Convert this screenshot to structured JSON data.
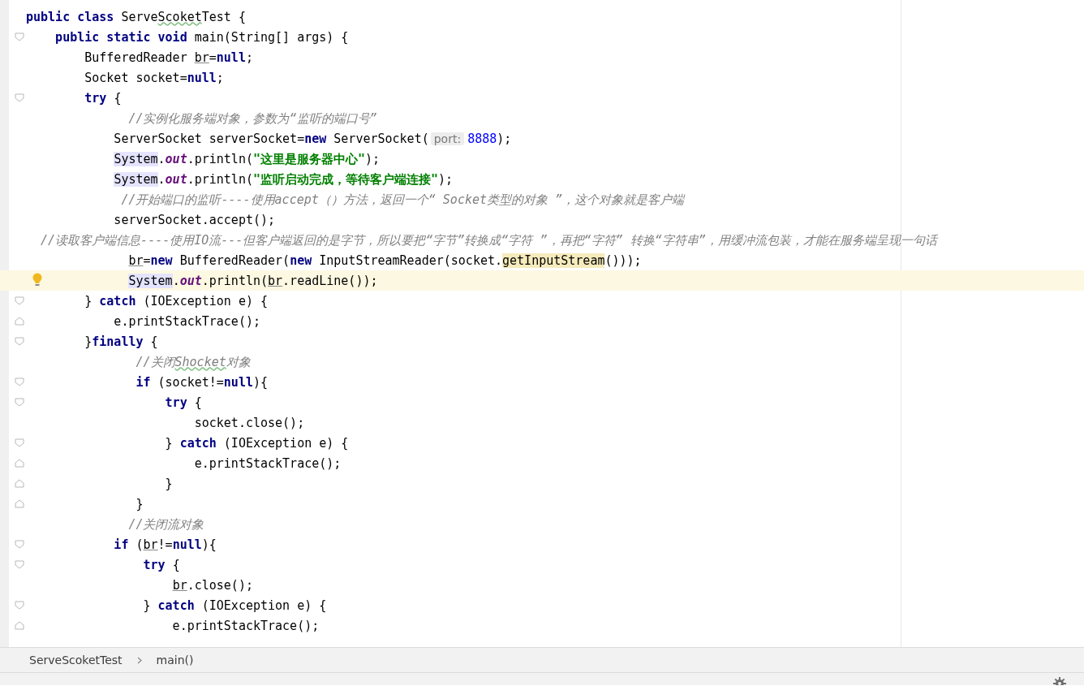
{
  "editor": {
    "lines": [
      {
        "current": false,
        "tokens": [
          {
            "kind": "keyword",
            "text": "public class "
          },
          {
            "kind": "plain",
            "text": "Serve"
          },
          {
            "kind": "typo",
            "text": "Scoket"
          },
          {
            "kind": "plain",
            "text": "Test {"
          }
        ]
      },
      {
        "current": false,
        "fold_start": true,
        "tokens": [
          {
            "kind": "keyword",
            "text": "    public static void "
          },
          {
            "kind": "plain",
            "text": "main(String[] args) {"
          }
        ]
      },
      {
        "current": false,
        "tokens": [
          {
            "kind": "plain",
            "text": "        BufferedReader "
          },
          {
            "kind": "underlined",
            "text": "br"
          },
          {
            "kind": "plain",
            "text": "="
          },
          {
            "kind": "keyword",
            "text": "null"
          },
          {
            "kind": "plain",
            "text": ";"
          }
        ]
      },
      {
        "current": false,
        "tokens": [
          {
            "kind": "plain",
            "text": "        Socket socket="
          },
          {
            "kind": "keyword",
            "text": "null"
          },
          {
            "kind": "plain",
            "text": ";"
          }
        ]
      },
      {
        "current": false,
        "fold_start": true,
        "tokens": [
          {
            "kind": "keyword",
            "text": "        try "
          },
          {
            "kind": "plain",
            "text": "{"
          }
        ]
      },
      {
        "current": false,
        "tokens": [
          {
            "kind": "comment",
            "text": "              //实例化服务端对象，参数为“监听的端口号”"
          }
        ]
      },
      {
        "current": false,
        "tokens": [
          {
            "kind": "plain",
            "text": "            ServerSocket serverSocket="
          },
          {
            "kind": "keyword",
            "text": "new "
          },
          {
            "kind": "plain",
            "text": "ServerSocket("
          },
          {
            "kind": "hint",
            "text": "port:"
          },
          {
            "kind": "number",
            "text": "8888"
          },
          {
            "kind": "plain",
            "text": ");"
          }
        ]
      },
      {
        "current": false,
        "tokens": [
          {
            "kind": "class-ref",
            "text": "            System"
          },
          {
            "kind": "plain",
            "text": "."
          },
          {
            "kind": "field",
            "text": "out"
          },
          {
            "kind": "plain",
            "text": ".println("
          },
          {
            "kind": "string",
            "text": "\"这里是服务器中心\""
          },
          {
            "kind": "plain",
            "text": ");"
          }
        ]
      },
      {
        "current": false,
        "tokens": [
          {
            "kind": "class-ref",
            "text": "            System"
          },
          {
            "kind": "plain",
            "text": "."
          },
          {
            "kind": "field",
            "text": "out"
          },
          {
            "kind": "plain",
            "text": ".println("
          },
          {
            "kind": "string",
            "text": "\"监听启动完成，等待客户端连接\""
          },
          {
            "kind": "plain",
            "text": ");"
          }
        ]
      },
      {
        "current": false,
        "tokens": [
          {
            "kind": "comment",
            "text": "             //开始端口的监听----使用accept（）方法，返回一个“ Socket类型的对象 ”，这个对象就是客户端"
          }
        ]
      },
      {
        "current": false,
        "tokens": [
          {
            "kind": "plain",
            "text": "            serverSocket.accept();"
          }
        ]
      },
      {
        "current": false,
        "tokens": [
          {
            "kind": "comment",
            "text": "  //读取客户端信息----使用IO流---但客户端返回的是字节，所以要把“字节”转换成“字符 ”，再把“字符” 转换“字符串”，用缓冲流包装，才能在服务端呈现一句话"
          }
        ]
      },
      {
        "current": false,
        "tokens": [
          {
            "kind": "underlined",
            "text": "              br"
          },
          {
            "kind": "plain",
            "text": "="
          },
          {
            "kind": "keyword",
            "text": "new "
          },
          {
            "kind": "plain",
            "text": "BufferedReader("
          },
          {
            "kind": "keyword",
            "text": "new "
          },
          {
            "kind": "plain",
            "text": "InputStreamReader(socket."
          },
          {
            "kind": "highlighted",
            "text": "getInputStream"
          },
          {
            "kind": "plain",
            "text": "()));"
          }
        ]
      },
      {
        "current": true,
        "bulb": true,
        "tokens": [
          {
            "kind": "class-ref",
            "text": "              System"
          },
          {
            "kind": "plain",
            "text": "."
          },
          {
            "kind": "field",
            "text": "out"
          },
          {
            "kind": "plain",
            "text": ".println("
          },
          {
            "kind": "underlined",
            "text": "br"
          },
          {
            "kind": "plain",
            "text": ".readLine());"
          }
        ]
      },
      {
        "current": false,
        "fold_start": true,
        "tokens": [
          {
            "kind": "plain",
            "text": "        } "
          },
          {
            "kind": "keyword",
            "text": "catch "
          },
          {
            "kind": "plain",
            "text": "(IOException e) {"
          }
        ]
      },
      {
        "current": false,
        "fold_end": true,
        "tokens": [
          {
            "kind": "plain",
            "text": "            e.printStackTrace();"
          }
        ]
      },
      {
        "current": false,
        "fold_start": true,
        "tokens": [
          {
            "kind": "plain",
            "text": "        }"
          },
          {
            "kind": "keyword",
            "text": "finally "
          },
          {
            "kind": "plain",
            "text": "{"
          }
        ]
      },
      {
        "current": false,
        "tokens": [
          {
            "kind": "comment",
            "text": "               //关闭"
          },
          {
            "kind": "comment-typo",
            "text": "Shocket"
          },
          {
            "kind": "comment",
            "text": "对象"
          }
        ]
      },
      {
        "current": false,
        "fold_start": true,
        "tokens": [
          {
            "kind": "keyword",
            "text": "               if "
          },
          {
            "kind": "plain",
            "text": "(socket!="
          },
          {
            "kind": "keyword",
            "text": "null"
          },
          {
            "kind": "plain",
            "text": "){"
          }
        ]
      },
      {
        "current": false,
        "fold_start": true,
        "tokens": [
          {
            "kind": "keyword",
            "text": "                   try "
          },
          {
            "kind": "plain",
            "text": "{"
          }
        ]
      },
      {
        "current": false,
        "tokens": [
          {
            "kind": "plain",
            "text": "                       socket.close();"
          }
        ]
      },
      {
        "current": false,
        "fold_start": true,
        "tokens": [
          {
            "kind": "plain",
            "text": "                   } "
          },
          {
            "kind": "keyword",
            "text": "catch "
          },
          {
            "kind": "plain",
            "text": "(IOException e) {"
          }
        ]
      },
      {
        "current": false,
        "fold_end": true,
        "tokens": [
          {
            "kind": "plain",
            "text": "                       e.printStackTrace();"
          }
        ]
      },
      {
        "current": false,
        "fold_end": true,
        "tokens": [
          {
            "kind": "plain",
            "text": "                   }"
          }
        ]
      },
      {
        "current": false,
        "fold_end": true,
        "tokens": [
          {
            "kind": "plain",
            "text": "               }"
          }
        ]
      },
      {
        "current": false,
        "tokens": [
          {
            "kind": "comment",
            "text": "              //关闭流对象"
          }
        ]
      },
      {
        "current": false,
        "fold_start": true,
        "tokens": [
          {
            "kind": "keyword",
            "text": "            if "
          },
          {
            "kind": "plain",
            "text": "("
          },
          {
            "kind": "underlined",
            "text": "br"
          },
          {
            "kind": "plain",
            "text": "!="
          },
          {
            "kind": "keyword",
            "text": "null"
          },
          {
            "kind": "plain",
            "text": "){"
          }
        ]
      },
      {
        "current": false,
        "fold_start": true,
        "tokens": [
          {
            "kind": "keyword",
            "text": "                try "
          },
          {
            "kind": "plain",
            "text": "{"
          }
        ]
      },
      {
        "current": false,
        "tokens": [
          {
            "kind": "underlined",
            "text": "                    br"
          },
          {
            "kind": "plain",
            "text": ".close();"
          }
        ]
      },
      {
        "current": false,
        "fold_start": true,
        "tokens": [
          {
            "kind": "plain",
            "text": "                } "
          },
          {
            "kind": "keyword",
            "text": "catch "
          },
          {
            "kind": "plain",
            "text": "(IOException e) {"
          }
        ]
      },
      {
        "current": false,
        "fold_end": true,
        "tokens": [
          {
            "kind": "plain",
            "text": "                    e.printStackTrace();"
          }
        ]
      }
    ]
  },
  "breadcrumbs": [
    {
      "label": "ServeScoketTest"
    },
    {
      "label": "main()"
    }
  ]
}
